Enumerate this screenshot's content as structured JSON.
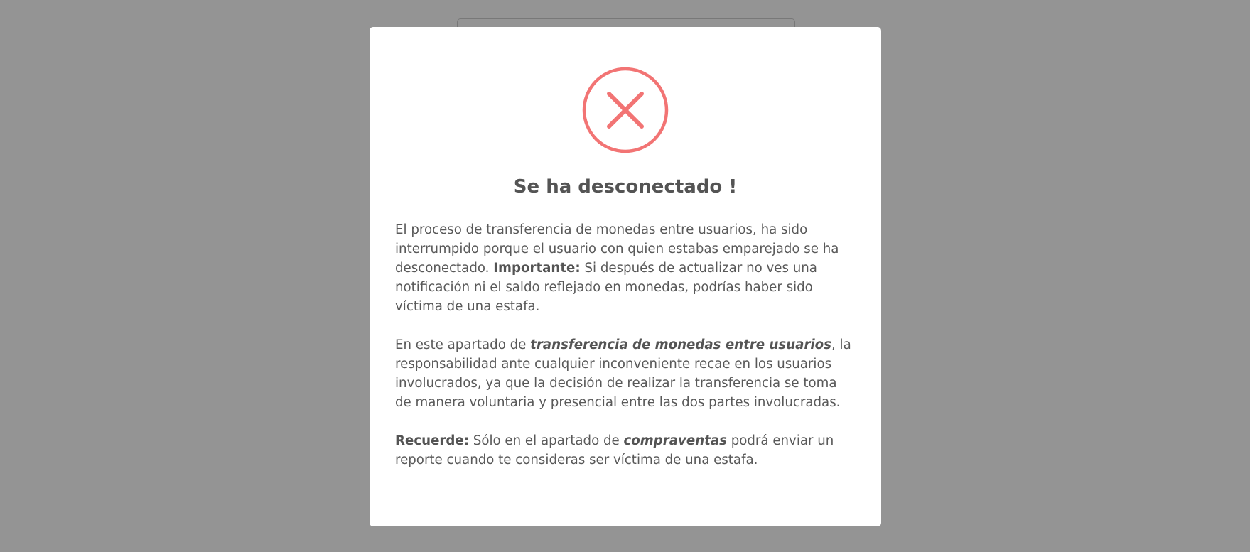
{
  "background": {
    "overlay_color": "#000000"
  },
  "modal": {
    "icon": "error-x-icon",
    "icon_color": "#f27474",
    "title": "Se ha desconectado !",
    "paragraph1": {
      "text_a": "El proceso de transferencia de monedas entre usuarios, ha sido interrumpido porque el usuario con quien estabas emparejado se ha desconectado. ",
      "bold": "Importante:",
      "text_b": " Si después de actualizar no ves una notificación ni el saldo reflejado en monedas, podrías haber sido víctima de una estafa."
    },
    "paragraph2": {
      "text_a": "En este apartado de ",
      "bold_italic": "transferencia de monedas entre usuarios",
      "text_b": ", la responsabilidad ante cualquier inconveniente recae en los usuarios involucrados, ya que la decisión de realizar la transferencia se toma de manera voluntaria y presencial entre las dos partes involucradas."
    },
    "paragraph3": {
      "bold": "Recuerde:",
      "text_a": " Sólo en el apartado de ",
      "bold_italic": "compraventas",
      "text_b": " podrá enviar un reporte cuando te consideras ser víctima de una estafa."
    }
  }
}
